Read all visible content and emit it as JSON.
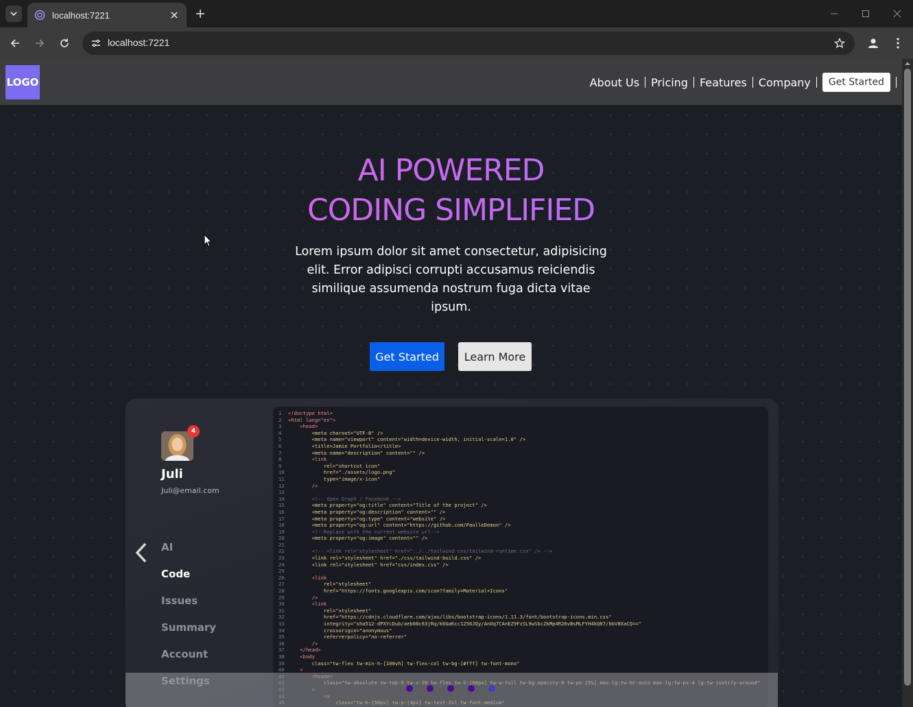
{
  "browser": {
    "tab_title": "localhost:7221",
    "url": "localhost:7221"
  },
  "header": {
    "logo": "LOGO",
    "nav": [
      "About Us",
      "Pricing",
      "Features",
      "Company"
    ],
    "cta": "Get Started"
  },
  "hero": {
    "title_line1": "AI POWERED",
    "title_line2": "CODING SIMPLIFIED",
    "description": "Lorem ipsum dolor sit amet consectetur, adipisicing elit. Error adipisci corrupti accusamus reiciendis similique assumenda nostrum fuga dicta vitae ipsum.",
    "primary_button": "Get Started",
    "secondary_button": "Learn More"
  },
  "showcase": {
    "badge_count": "4",
    "user_name": "Juli",
    "user_email": "Juli@email.com",
    "menu": [
      {
        "label": "AI",
        "active": false
      },
      {
        "label": "Code",
        "active": true
      },
      {
        "label": "Issues",
        "active": false
      },
      {
        "label": "Summary",
        "active": false
      },
      {
        "label": "Account",
        "active": false
      },
      {
        "label": "Settings",
        "active": false
      }
    ],
    "dots_total": 5,
    "dots_active_index": 4,
    "code_lines": [
      {
        "n": "1",
        "t": "<!doctype html>",
        "k": "tag"
      },
      {
        "n": "2",
        "t": "<html lang=\"en\">",
        "k": "tag"
      },
      {
        "n": "3",
        "t": "    <head>",
        "k": "tag"
      },
      {
        "n": "4",
        "t": "        <meta charset=\"UTF-8\" />",
        "k": "str"
      },
      {
        "n": "5",
        "t": "        <meta name=\"viewport\" content=\"width=device-width, initial-scale=1.0\" />",
        "k": "str"
      },
      {
        "n": "6",
        "t": "        <title>Jamie Portfolio</title>",
        "k": "str"
      },
      {
        "n": "7",
        "t": "        <meta name=\"description\" content=\"\" />",
        "k": "str"
      },
      {
        "n": "8",
        "t": "        <link",
        "k": "tag"
      },
      {
        "n": "9",
        "t": "            rel=\"shortcut icon\"",
        "k": "str"
      },
      {
        "n": "10",
        "t": "            href=\"./assets/logo.png\"",
        "k": "str"
      },
      {
        "n": "11",
        "t": "            type=\"image/x-icon\"",
        "k": "str"
      },
      {
        "n": "12",
        "t": "        />",
        "k": "tag"
      },
      {
        "n": "13",
        "t": "",
        "k": "str"
      },
      {
        "n": "14",
        "t": "        <!-- Open Graph / Facebook -->",
        "k": "cm"
      },
      {
        "n": "15",
        "t": "        <meta property=\"og:title\" content=\"Title of the project\" />",
        "k": "str"
      },
      {
        "n": "16",
        "t": "        <meta property=\"og:description\" content=\"\" />",
        "k": "str"
      },
      {
        "n": "17",
        "t": "        <meta property=\"og:type\" content=\"website\" />",
        "k": "str"
      },
      {
        "n": "18",
        "t": "        <meta property=\"og:url\" content=\"https://github.com/PaulleDemon\" />",
        "k": "str"
      },
      {
        "n": "19",
        "t": "        <!--Replace with the current website url-->",
        "k": "cm"
      },
      {
        "n": "20",
        "t": "        <meta property=\"og:image\" content=\"\" />",
        "k": "str"
      },
      {
        "n": "21",
        "t": "",
        "k": "str"
      },
      {
        "n": "22",
        "t": "        <!-- <link rel=\"stylesheet\" href=\"../../tailwind-css/tailwind-runtime.css\" /> -->",
        "k": "cm"
      },
      {
        "n": "23",
        "t": "        <link rel=\"stylesheet\" href=\"./css/tailwind-build.css\" />",
        "k": "str"
      },
      {
        "n": "24",
        "t": "        <link rel=\"stylesheet\" href=\"css/index.css\" />",
        "k": "str"
      },
      {
        "n": "25",
        "t": "",
        "k": "str"
      },
      {
        "n": "26",
        "t": "        <link",
        "k": "tag"
      },
      {
        "n": "27",
        "t": "            rel=\"stylesheet\"",
        "k": "str"
      },
      {
        "n": "28",
        "t": "            href=\"https://fonts.googleapis.com/icon?family=Material+Icons\"",
        "k": "str"
      },
      {
        "n": "29",
        "t": "        />",
        "k": "tag"
      },
      {
        "n": "30",
        "t": "        <link",
        "k": "tag"
      },
      {
        "n": "31",
        "t": "            rel=\"stylesheet\"",
        "k": "str"
      },
      {
        "n": "32",
        "t": "            href=\"https://cdnjs.cloudflare.com/ajax/libs/bootstrap-icons/1.11.3/font/bootstrap-icons.min.css\"",
        "k": "str"
      },
      {
        "n": "33",
        "t": "            integrity=\"sha512-dPXYcDub/aeb08c63jRq/k6GaKcc1256JQy/AnOq7CAnEZ9FzSL9wSbcZkMp4R26vBsMLFYH4kQ67/bbV8XaCQ==\"",
        "k": "str"
      },
      {
        "n": "34",
        "t": "            crossorigin=\"anonymous\"",
        "k": "str"
      },
      {
        "n": "35",
        "t": "            referrerpolicy=\"no-referrer\"",
        "k": "str"
      },
      {
        "n": "36",
        "t": "        />",
        "k": "tag"
      },
      {
        "n": "37",
        "t": "    </head>",
        "k": "tag"
      },
      {
        "n": "38",
        "t": "    <body",
        "k": "tag"
      },
      {
        "n": "39",
        "t": "        class=\"tw-flex tw-min-h-[100vh] tw-flex-col tw-bg-[#fff] tw-font-mono\"",
        "k": "str"
      },
      {
        "n": "40",
        "t": "    >",
        "k": "tag"
      },
      {
        "n": "41",
        "t": "        <header",
        "k": "tag"
      },
      {
        "n": "42",
        "t": "            class=\"tw-absolute tw-top-0 tw-z-20 tw-flex tw-h-[60px] tw-w-full tw-bg-opacity-0 tw-px-[5%] max-lg:tw-mr-auto max-lg:tw-px-4 lg:tw-justify-around\"",
        "k": "str"
      },
      {
        "n": "43",
        "t": "        >",
        "k": "tag"
      },
      {
        "n": "44",
        "t": "            <a",
        "k": "tag"
      },
      {
        "n": "45",
        "t": "                class=\"tw-h-[50px] tw-p-[4px] tw-text-2xl tw-font-medium\"",
        "k": "str"
      }
    ]
  }
}
